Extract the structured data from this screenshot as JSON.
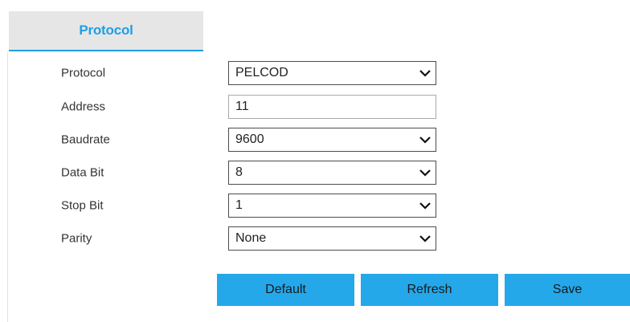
{
  "tab": {
    "label": "Protocol"
  },
  "form": {
    "protocol": {
      "label": "Protocol",
      "value": "PELCOD"
    },
    "address": {
      "label": "Address",
      "value": "11"
    },
    "baudrate": {
      "label": "Baudrate",
      "value": "9600"
    },
    "data_bit": {
      "label": "Data Bit",
      "value": "8"
    },
    "stop_bit": {
      "label": "Stop Bit",
      "value": "1"
    },
    "parity": {
      "label": "Parity",
      "value": "None"
    }
  },
  "buttons": {
    "default_label": "Default",
    "refresh_label": "Refresh",
    "save_label": "Save"
  },
  "colors": {
    "accent": "#1e9fe6",
    "button": "#24a8ea",
    "tab_background": "#e6e6e6"
  },
  "icons": {
    "select": "chevron-down-icon"
  }
}
